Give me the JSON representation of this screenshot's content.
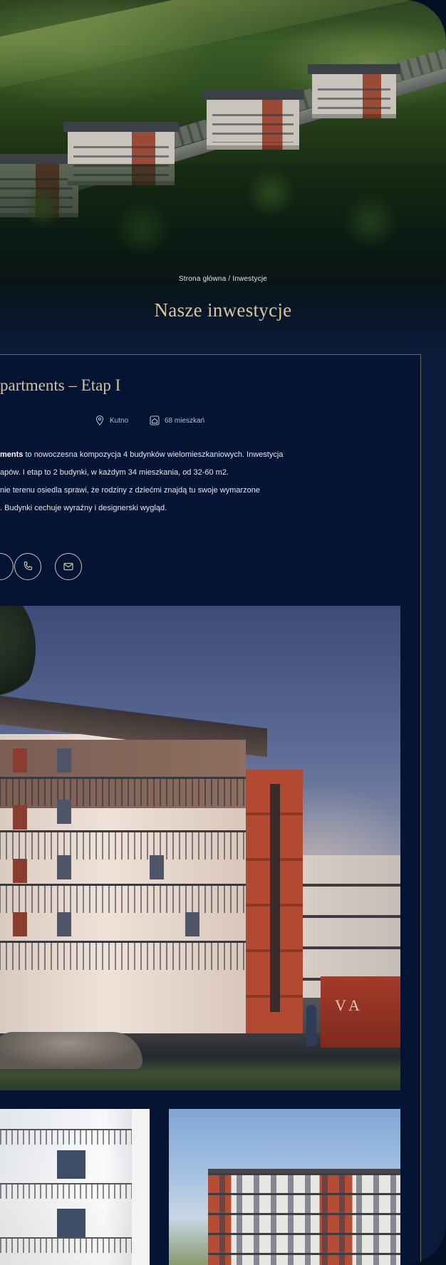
{
  "hero": {
    "breadcrumb": "Strona główna / Inwestycje",
    "title": "Nasze inwestycje"
  },
  "investment": {
    "title": "partments – Etap I",
    "location": "Kutno",
    "units": "68 mieszkań",
    "description_lines": [
      {
        "bold": "ments",
        "text": " to nowoczesna kompozycja 4 budynków wielomieszkaniowych. Inwestycja"
      },
      {
        "bold": "",
        "text": "apów. I etap to 2 budynki, w każdym 34 mieszkania, od 32-60 m2."
      },
      {
        "bold": "",
        "text": "nie terenu osiedla sprawi, że rodziny z dziećmi znajdą tu swoje wymarzone"
      },
      {
        "bold": "",
        "text": ". Budynki cechuje wyraźny i designerski wygląd."
      }
    ],
    "render_sign": "VA"
  },
  "icons": {
    "location": "map-pin-icon",
    "units": "home-icon",
    "phone": "phone-icon",
    "email": "mail-icon"
  },
  "colors": {
    "background": "#051433",
    "accent_gold": "#d3c39f",
    "card_border": "#6c6a59"
  }
}
